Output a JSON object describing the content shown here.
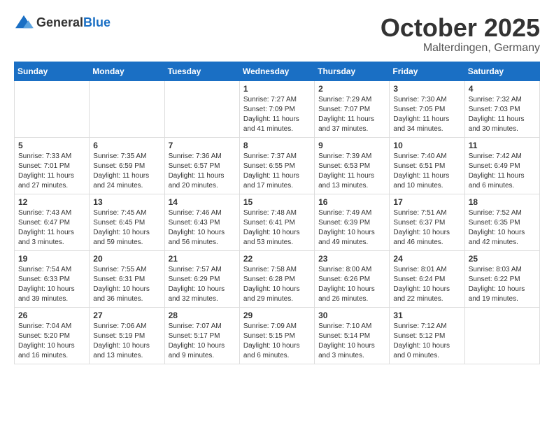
{
  "header": {
    "logo_general": "General",
    "logo_blue": "Blue",
    "month": "October 2025",
    "location": "Malterdingen, Germany"
  },
  "days_of_week": [
    "Sunday",
    "Monday",
    "Tuesday",
    "Wednesday",
    "Thursday",
    "Friday",
    "Saturday"
  ],
  "weeks": [
    [
      {
        "day": "",
        "info": ""
      },
      {
        "day": "",
        "info": ""
      },
      {
        "day": "",
        "info": ""
      },
      {
        "day": "1",
        "info": "Sunrise: 7:27 AM\nSunset: 7:09 PM\nDaylight: 11 hours and 41 minutes."
      },
      {
        "day": "2",
        "info": "Sunrise: 7:29 AM\nSunset: 7:07 PM\nDaylight: 11 hours and 37 minutes."
      },
      {
        "day": "3",
        "info": "Sunrise: 7:30 AM\nSunset: 7:05 PM\nDaylight: 11 hours and 34 minutes."
      },
      {
        "day": "4",
        "info": "Sunrise: 7:32 AM\nSunset: 7:03 PM\nDaylight: 11 hours and 30 minutes."
      }
    ],
    [
      {
        "day": "5",
        "info": "Sunrise: 7:33 AM\nSunset: 7:01 PM\nDaylight: 11 hours and 27 minutes."
      },
      {
        "day": "6",
        "info": "Sunrise: 7:35 AM\nSunset: 6:59 PM\nDaylight: 11 hours and 24 minutes."
      },
      {
        "day": "7",
        "info": "Sunrise: 7:36 AM\nSunset: 6:57 PM\nDaylight: 11 hours and 20 minutes."
      },
      {
        "day": "8",
        "info": "Sunrise: 7:37 AM\nSunset: 6:55 PM\nDaylight: 11 hours and 17 minutes."
      },
      {
        "day": "9",
        "info": "Sunrise: 7:39 AM\nSunset: 6:53 PM\nDaylight: 11 hours and 13 minutes."
      },
      {
        "day": "10",
        "info": "Sunrise: 7:40 AM\nSunset: 6:51 PM\nDaylight: 11 hours and 10 minutes."
      },
      {
        "day": "11",
        "info": "Sunrise: 7:42 AM\nSunset: 6:49 PM\nDaylight: 11 hours and 6 minutes."
      }
    ],
    [
      {
        "day": "12",
        "info": "Sunrise: 7:43 AM\nSunset: 6:47 PM\nDaylight: 11 hours and 3 minutes."
      },
      {
        "day": "13",
        "info": "Sunrise: 7:45 AM\nSunset: 6:45 PM\nDaylight: 10 hours and 59 minutes."
      },
      {
        "day": "14",
        "info": "Sunrise: 7:46 AM\nSunset: 6:43 PM\nDaylight: 10 hours and 56 minutes."
      },
      {
        "day": "15",
        "info": "Sunrise: 7:48 AM\nSunset: 6:41 PM\nDaylight: 10 hours and 53 minutes."
      },
      {
        "day": "16",
        "info": "Sunrise: 7:49 AM\nSunset: 6:39 PM\nDaylight: 10 hours and 49 minutes."
      },
      {
        "day": "17",
        "info": "Sunrise: 7:51 AM\nSunset: 6:37 PM\nDaylight: 10 hours and 46 minutes."
      },
      {
        "day": "18",
        "info": "Sunrise: 7:52 AM\nSunset: 6:35 PM\nDaylight: 10 hours and 42 minutes."
      }
    ],
    [
      {
        "day": "19",
        "info": "Sunrise: 7:54 AM\nSunset: 6:33 PM\nDaylight: 10 hours and 39 minutes."
      },
      {
        "day": "20",
        "info": "Sunrise: 7:55 AM\nSunset: 6:31 PM\nDaylight: 10 hours and 36 minutes."
      },
      {
        "day": "21",
        "info": "Sunrise: 7:57 AM\nSunset: 6:29 PM\nDaylight: 10 hours and 32 minutes."
      },
      {
        "day": "22",
        "info": "Sunrise: 7:58 AM\nSunset: 6:28 PM\nDaylight: 10 hours and 29 minutes."
      },
      {
        "day": "23",
        "info": "Sunrise: 8:00 AM\nSunset: 6:26 PM\nDaylight: 10 hours and 26 minutes."
      },
      {
        "day": "24",
        "info": "Sunrise: 8:01 AM\nSunset: 6:24 PM\nDaylight: 10 hours and 22 minutes."
      },
      {
        "day": "25",
        "info": "Sunrise: 8:03 AM\nSunset: 6:22 PM\nDaylight: 10 hours and 19 minutes."
      }
    ],
    [
      {
        "day": "26",
        "info": "Sunrise: 7:04 AM\nSunset: 5:20 PM\nDaylight: 10 hours and 16 minutes."
      },
      {
        "day": "27",
        "info": "Sunrise: 7:06 AM\nSunset: 5:19 PM\nDaylight: 10 hours and 13 minutes."
      },
      {
        "day": "28",
        "info": "Sunrise: 7:07 AM\nSunset: 5:17 PM\nDaylight: 10 hours and 9 minutes."
      },
      {
        "day": "29",
        "info": "Sunrise: 7:09 AM\nSunset: 5:15 PM\nDaylight: 10 hours and 6 minutes."
      },
      {
        "day": "30",
        "info": "Sunrise: 7:10 AM\nSunset: 5:14 PM\nDaylight: 10 hours and 3 minutes."
      },
      {
        "day": "31",
        "info": "Sunrise: 7:12 AM\nSunset: 5:12 PM\nDaylight: 10 hours and 0 minutes."
      },
      {
        "day": "",
        "info": ""
      }
    ]
  ]
}
